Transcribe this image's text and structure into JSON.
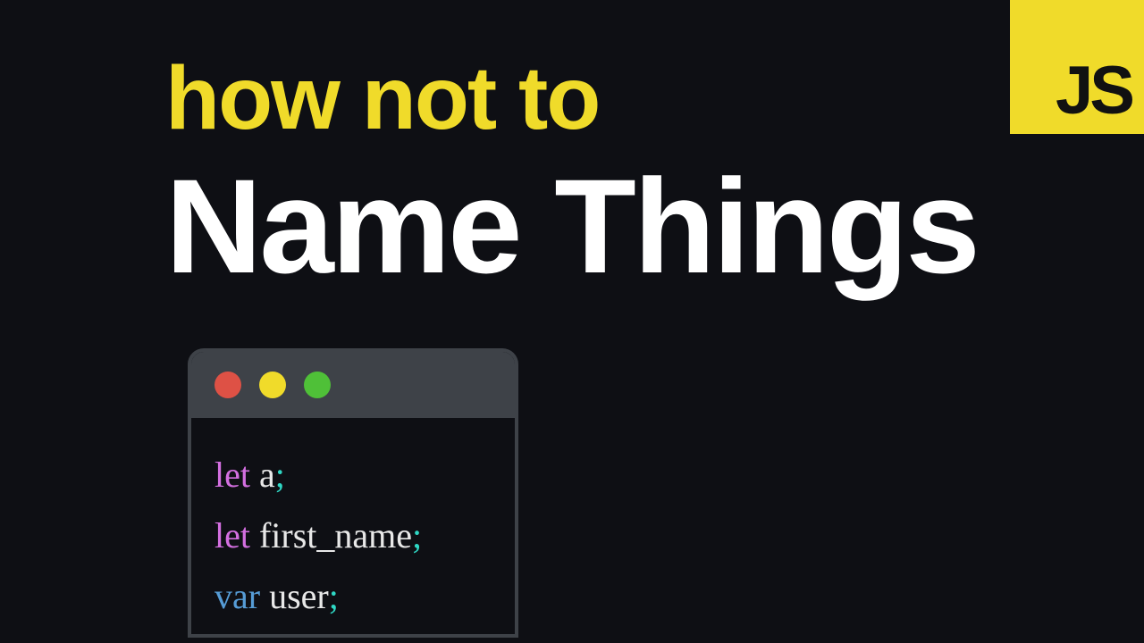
{
  "badge": {
    "label": "JS"
  },
  "title": {
    "line1": "how not to",
    "line2": "Name Things"
  },
  "code": {
    "lines": [
      {
        "keyword": "let",
        "keywordClass": "kw-let",
        "ident": "a",
        "semi": ";"
      },
      {
        "keyword": "let",
        "keywordClass": "kw-let",
        "ident": "first_name",
        "semi": ";"
      },
      {
        "keyword": "var",
        "keywordClass": "kw-var",
        "ident": "user",
        "semi": ";"
      }
    ]
  },
  "colors": {
    "background": "#0e0f14",
    "accent": "#f0db2a",
    "keyword_let": "#d36fe0",
    "keyword_var": "#569cd6",
    "identifier": "#e8e8e8",
    "semicolon": "#2fd8c5"
  }
}
